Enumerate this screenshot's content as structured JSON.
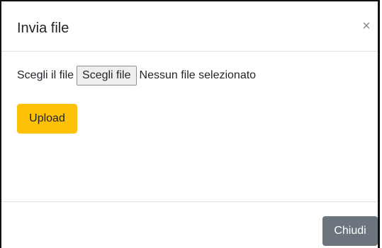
{
  "dialog": {
    "title": "Invia file",
    "close_glyph": "×"
  },
  "file_input": {
    "label": "Scegli il file",
    "button_label": "Scegli file",
    "status": "Nessun file selezionato"
  },
  "upload_button": {
    "label": "Upload",
    "color": "#ffc107"
  },
  "footer": {
    "close_label": "Chiudi",
    "close_color": "#6c757d"
  }
}
